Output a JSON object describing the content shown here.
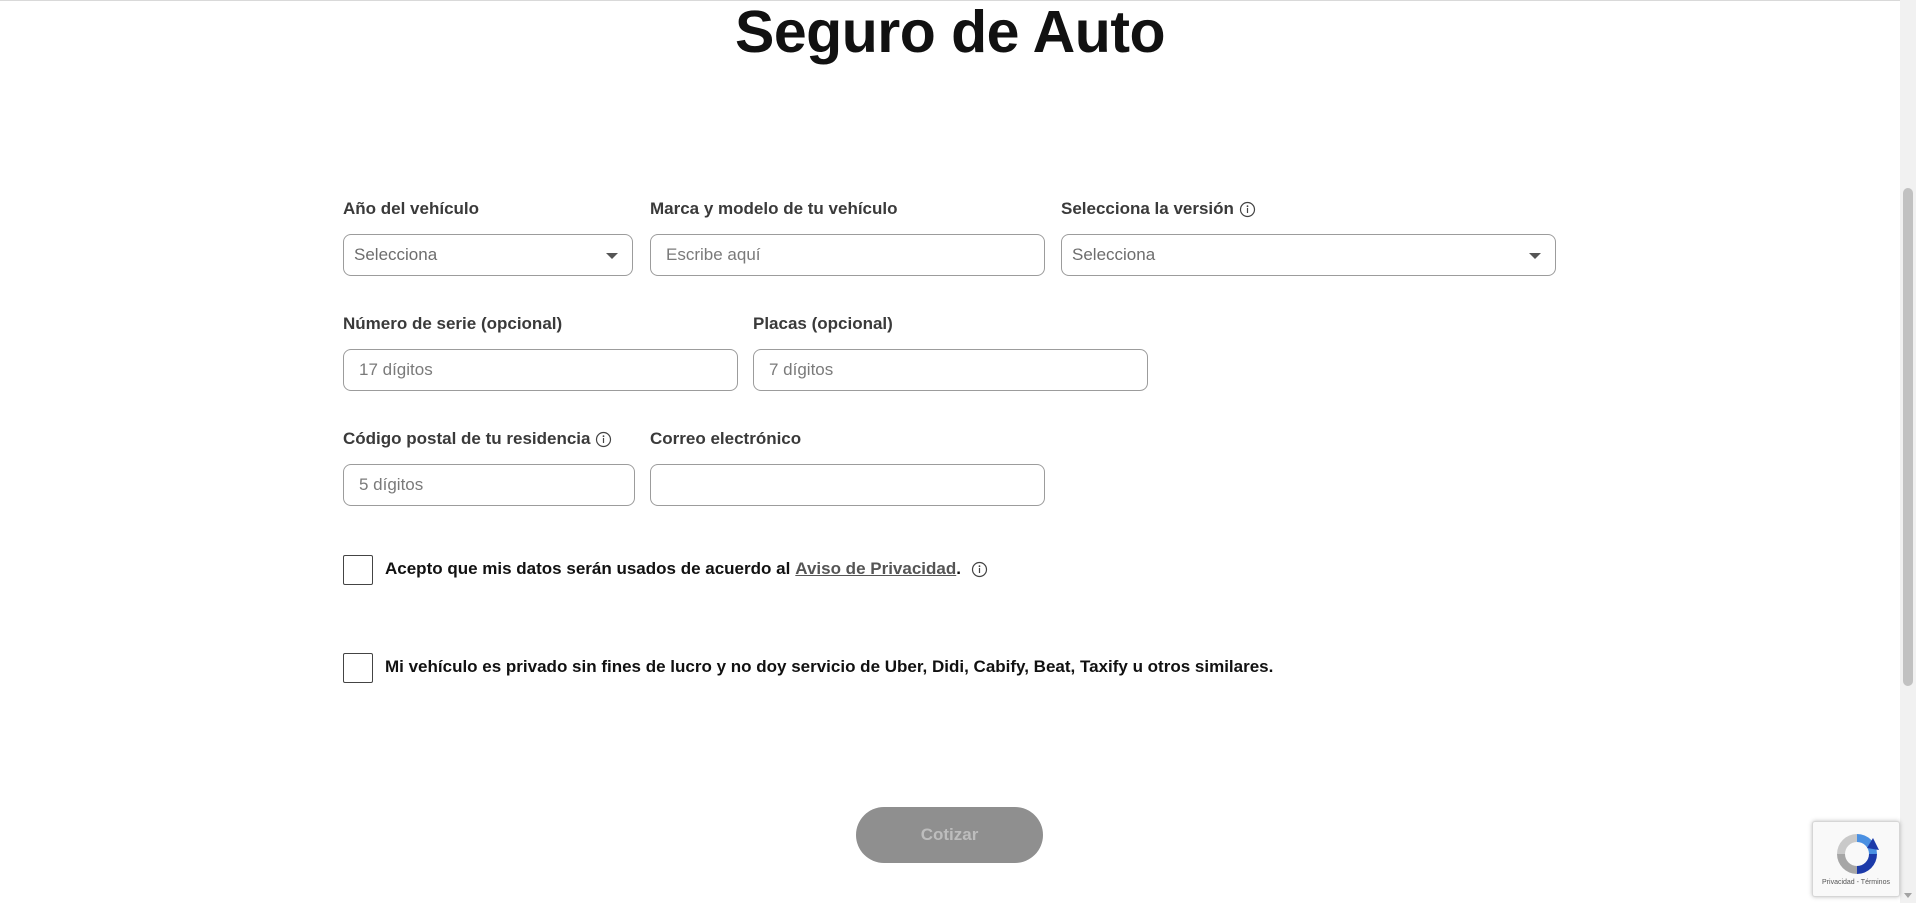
{
  "page": {
    "title": "Seguro de Auto"
  },
  "form": {
    "year": {
      "label": "Año del vehículo",
      "selected": "Selecciona"
    },
    "make_model": {
      "label": "Marca y modelo de tu vehículo",
      "placeholder": "Escribe aquí",
      "value": ""
    },
    "version": {
      "label": "Selecciona la versión",
      "selected": "Selecciona"
    },
    "serial": {
      "label": "Número de serie (opcional)",
      "placeholder": "17 dígitos",
      "value": ""
    },
    "plates": {
      "label": "Placas (opcional)",
      "placeholder": "7 dígitos",
      "value": ""
    },
    "postal_code": {
      "label": "Código postal de tu residencia",
      "placeholder": "5 dígitos",
      "value": ""
    },
    "email": {
      "label": "Correo electrónico",
      "placeholder": "",
      "value": ""
    },
    "consent_privacy": {
      "text": "Acepto que mis datos serán usados de acuerdo al",
      "link": "Aviso de Privacidad",
      "suffix": ".",
      "checked": false
    },
    "consent_private_vehicle": {
      "text": "Mi vehículo es privado sin fines de lucro y no doy servicio de Uber, Didi, Cabify, Beat, Taxify u otros similares.",
      "checked": false
    },
    "submit_label": "Cotizar"
  },
  "recaptcha": {
    "text": "Privacidad - Términos"
  },
  "colors": {
    "title": "#111111",
    "label": "#3a3a3a",
    "border": "#9c9c9c",
    "button_disabled_bg": "#8f8f8f",
    "button_disabled_text": "#bdbdbd",
    "recaptcha_blue": "#4a90e2"
  },
  "icons": {
    "info": "info-circle-icon",
    "dropdown": "caret-down-icon",
    "recaptcha": "recaptcha-logo-icon"
  }
}
